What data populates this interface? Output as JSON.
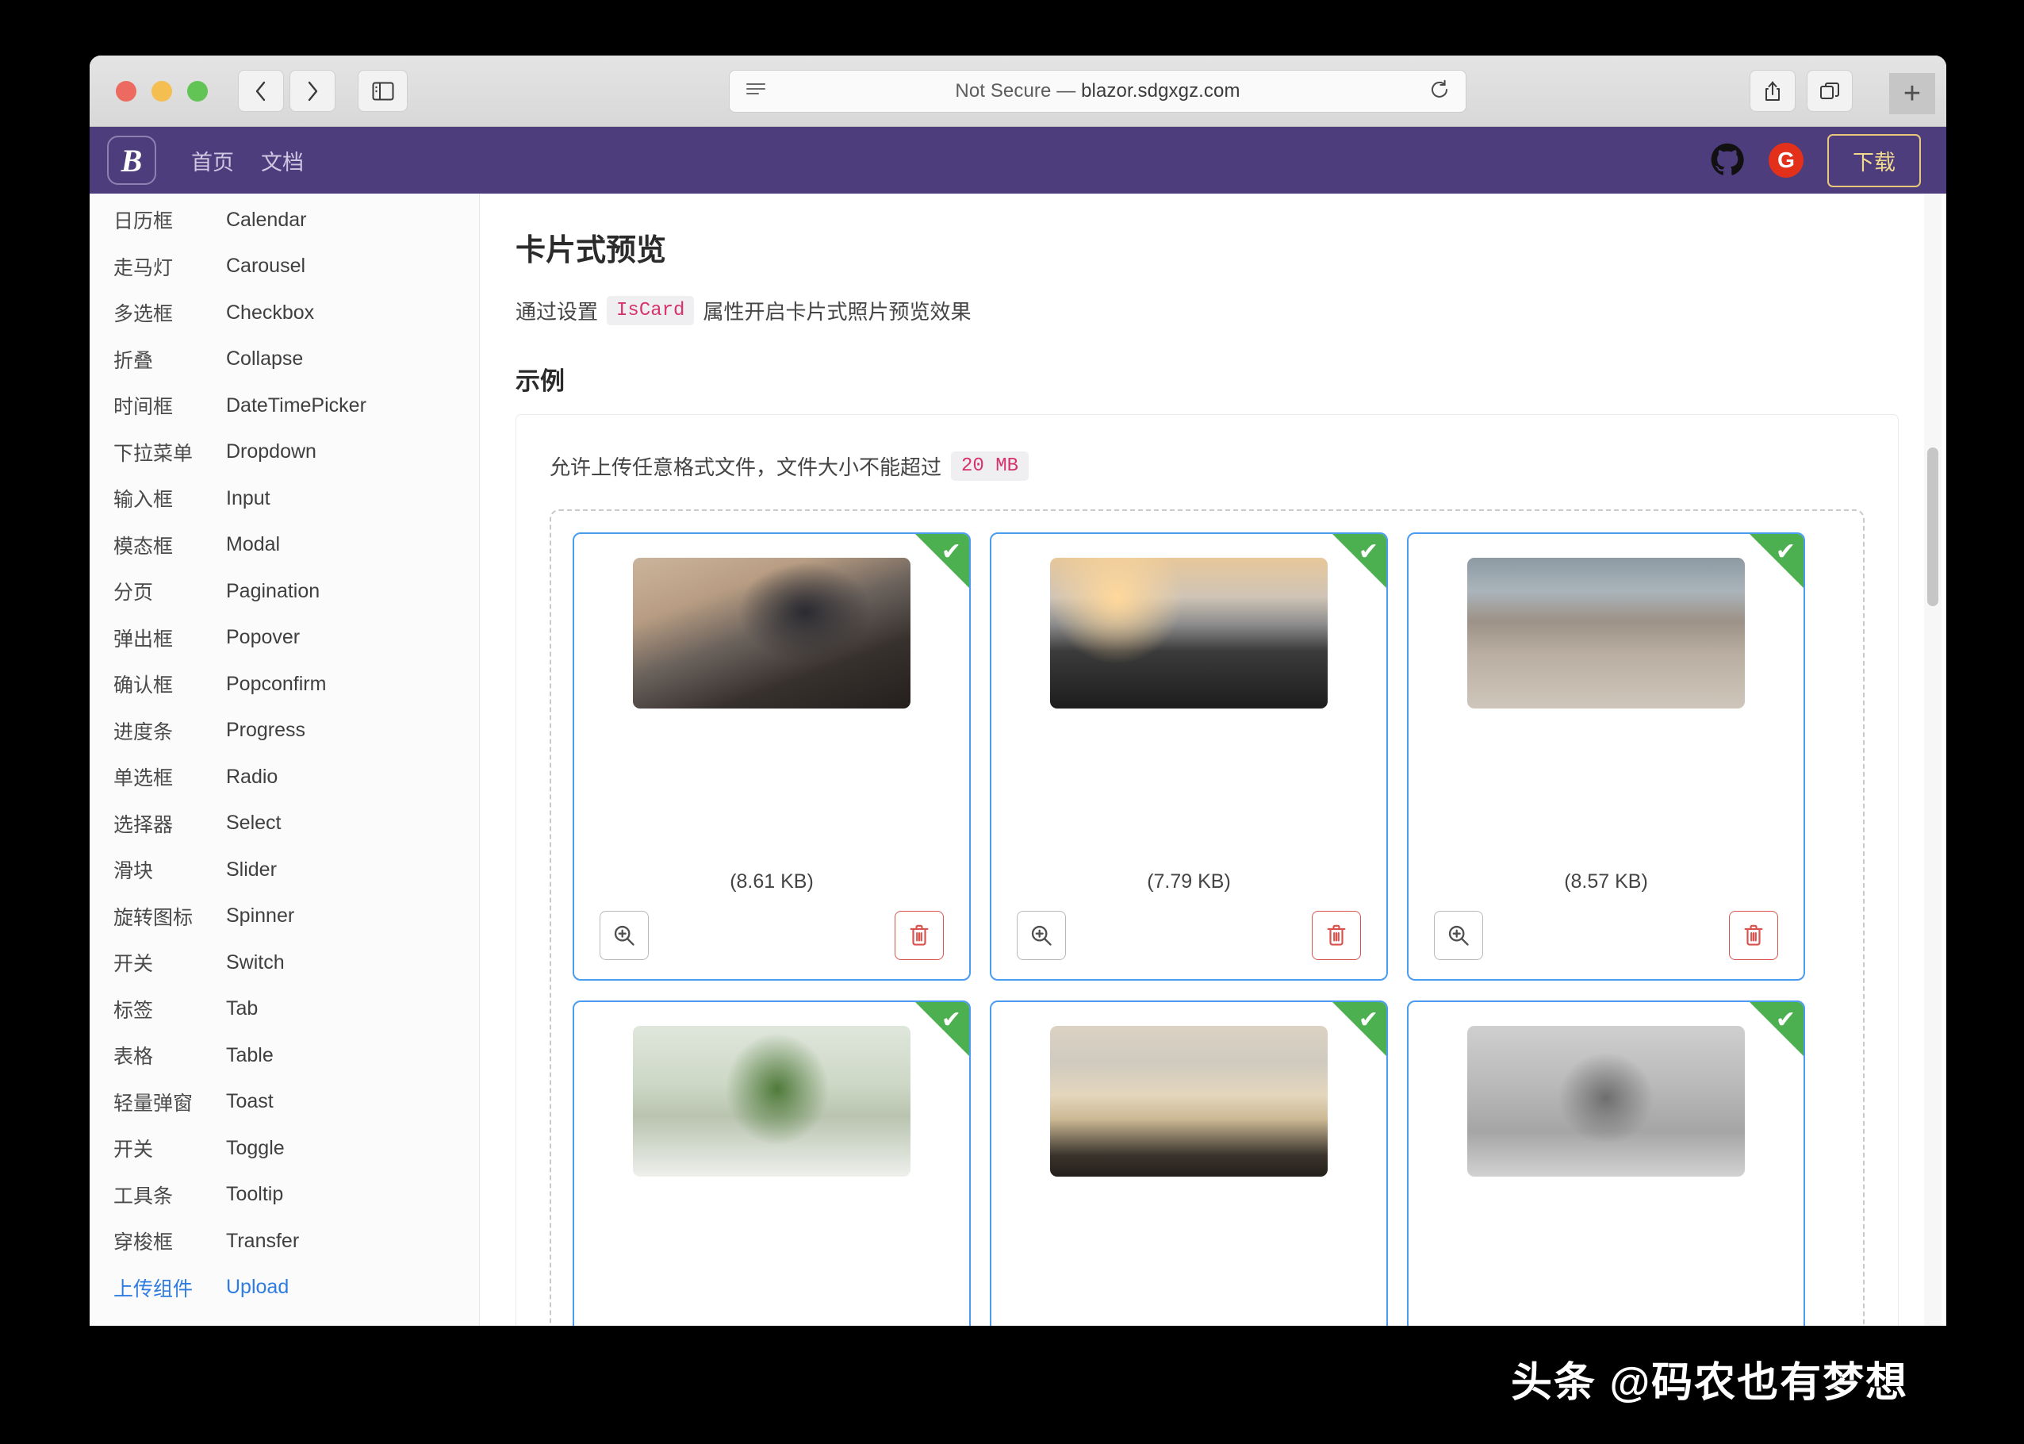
{
  "browser": {
    "url_prefix": "Not Secure — ",
    "url": "blazor.sdgxgz.com",
    "back_icon": "chevron-left-icon",
    "forward_icon": "chevron-right-icon",
    "sidebar_icon": "sidebar-toggle-icon",
    "reader_icon": "reader-view-icon",
    "reload_icon": "reload-icon",
    "share_icon": "share-icon",
    "tabs_icon": "tab-overview-icon",
    "newtab_label": "+"
  },
  "navbar": {
    "logo_text": "B",
    "links": [
      {
        "label": "首页"
      },
      {
        "label": "文档"
      }
    ],
    "github_icon": "github-icon",
    "gitee_icon": "gitee-icon",
    "gitee_letter": "G",
    "download_label": "下载",
    "brand_color": "#4e3d7d",
    "download_border_color": "#e8c97c"
  },
  "sidebar": {
    "items": [
      {
        "cn": "日历框",
        "en": "Calendar",
        "active": false
      },
      {
        "cn": "走马灯",
        "en": "Carousel",
        "active": false
      },
      {
        "cn": "多选框",
        "en": "Checkbox",
        "active": false
      },
      {
        "cn": "折叠",
        "en": "Collapse",
        "active": false
      },
      {
        "cn": "时间框",
        "en": "DateTimePicker",
        "active": false
      },
      {
        "cn": "下拉菜单",
        "en": "Dropdown",
        "active": false
      },
      {
        "cn": "输入框",
        "en": "Input",
        "active": false
      },
      {
        "cn": "模态框",
        "en": "Modal",
        "active": false
      },
      {
        "cn": "分页",
        "en": "Pagination",
        "active": false
      },
      {
        "cn": "弹出框",
        "en": "Popover",
        "active": false
      },
      {
        "cn": "确认框",
        "en": "Popconfirm",
        "active": false
      },
      {
        "cn": "进度条",
        "en": "Progress",
        "active": false
      },
      {
        "cn": "单选框",
        "en": "Radio",
        "active": false
      },
      {
        "cn": "选择器",
        "en": "Select",
        "active": false
      },
      {
        "cn": "滑块",
        "en": "Slider",
        "active": false
      },
      {
        "cn": "旋转图标",
        "en": "Spinner",
        "active": false
      },
      {
        "cn": "开关",
        "en": "Switch",
        "active": false
      },
      {
        "cn": "标签",
        "en": "Tab",
        "active": false
      },
      {
        "cn": "表格",
        "en": "Table",
        "active": false
      },
      {
        "cn": "轻量弹窗",
        "en": "Toast",
        "active": false
      },
      {
        "cn": "开关",
        "en": "Toggle",
        "active": false
      },
      {
        "cn": "工具条",
        "en": "Tooltip",
        "active": false
      },
      {
        "cn": "穿梭框",
        "en": "Transfer",
        "active": false
      },
      {
        "cn": "上传组件",
        "en": "Upload",
        "active": true
      }
    ],
    "active_color": "#2f7ce0"
  },
  "main": {
    "title": "卡片式预览",
    "desc_before": "通过设置",
    "desc_code": "IsCard",
    "desc_after": "属性开启卡片式照片预览效果",
    "section_title": "示例",
    "hint_text": "允许上传任意格式文件，文件大小不能超过",
    "hint_limit": "20 MB",
    "code_color": "#d6336c",
    "card_border_color": "#4a9cf0",
    "ribbon_color": "#4caf50",
    "files": [
      {
        "size": "(8.61 KB)",
        "art": "img-person",
        "alt": "person-sitting-on-stool-photo",
        "show_actions": true
      },
      {
        "size": "(7.79 KB)",
        "art": "img-mountain",
        "alt": "mountain-sunrise-photo",
        "show_actions": true
      },
      {
        "size": "(8.57 KB)",
        "art": "img-bench",
        "alt": "bench-on-pier-photo",
        "show_actions": true
      },
      {
        "size": "",
        "art": "img-plant",
        "alt": "plant-on-balcony-photo",
        "show_actions": false
      },
      {
        "size": "",
        "art": "img-beach",
        "alt": "beach-rocks-photo",
        "show_actions": false
      },
      {
        "size": "",
        "art": "img-statue",
        "alt": "statue-of-liberty-photo",
        "show_actions": false
      }
    ],
    "zoom_icon": "zoom-in-icon",
    "delete_icon": "trash-icon",
    "check_glyph": "✔"
  },
  "watermark": {
    "text": "头条 @码农也有梦想"
  }
}
